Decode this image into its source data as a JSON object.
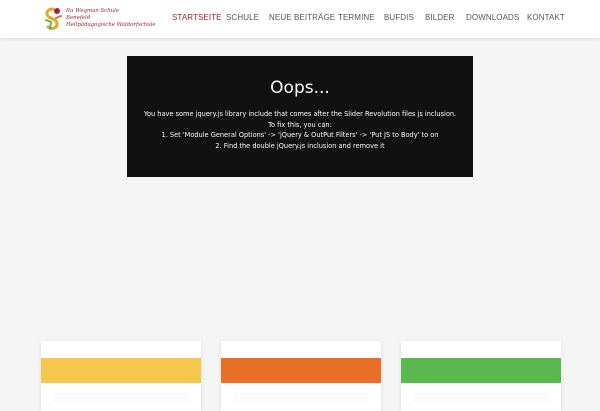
{
  "logo": {
    "lines": [
      "Ita Wegman Schule",
      "Benefeld",
      "Heilpädagogische Waldorfschule"
    ]
  },
  "nav": {
    "items": [
      {
        "label": "STARTSEITE",
        "active": true
      },
      {
        "label": "SCHULE",
        "active": false
      },
      {
        "label": "NEUE BEITRÄGE",
        "active": false
      },
      {
        "label": "TERMINE",
        "active": false
      },
      {
        "label": "BUFDIS",
        "active": false
      },
      {
        "label": "BILDER",
        "active": false
      },
      {
        "label": "DOWNLOADS",
        "active": false
      },
      {
        "label": "KONTAKT",
        "active": false
      }
    ]
  },
  "error_box": {
    "title": "Oops...",
    "lines": [
      "You have some jquery.js library include that comes after the Slider Revolution files js inclusion.",
      "To fix this, you can:",
      "1. Set 'Module General Options' -> 'jQuery & OutPut Filters' -> 'Put JS to Body' to on",
      "2. Find the double jQuery.js inclusion and remove it"
    ]
  },
  "cards": [
    {
      "color": "#f5c84c"
    },
    {
      "color": "#e96f26"
    },
    {
      "color": "#5ab94e"
    }
  ],
  "colors": {
    "accent": "#a4242c",
    "nav_text": "#555555",
    "page_bg": "#f5f5f5",
    "error_bg": "#111111"
  }
}
